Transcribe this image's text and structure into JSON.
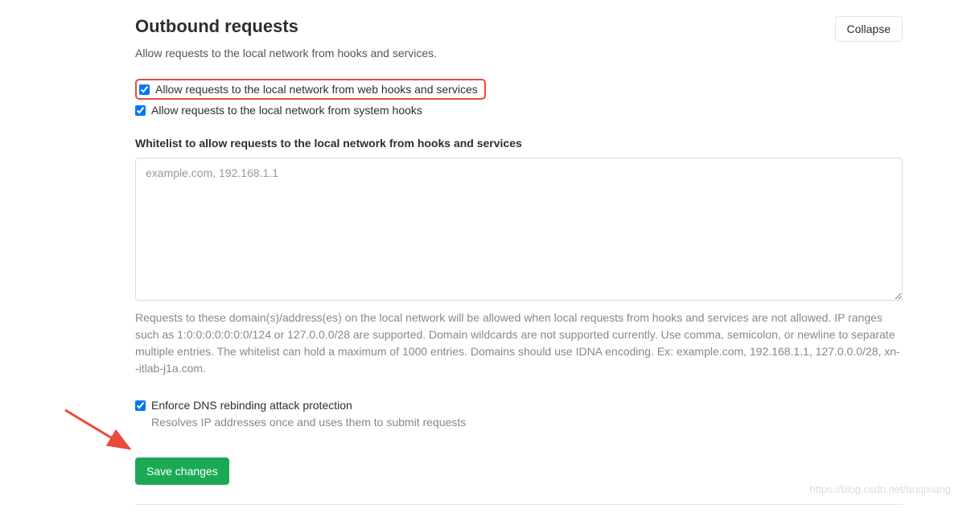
{
  "header": {
    "title": "Outbound requests",
    "subtitle": "Allow requests to the local network from hooks and services.",
    "collapse_label": "Collapse"
  },
  "checkboxes": {
    "allow_web_hooks": {
      "label": "Allow requests to the local network from web hooks and services",
      "checked": true
    },
    "allow_system_hooks": {
      "label": "Allow requests to the local network from system hooks",
      "checked": true
    }
  },
  "whitelist": {
    "label": "Whitelist to allow requests to the local network from hooks and services",
    "placeholder": "example.com, 192.168.1.1",
    "value": "",
    "help": "Requests to these domain(s)/address(es) on the local network will be allowed when local requests from hooks and services are not allowed. IP ranges such as 1:0:0:0:0:0:0:0/124 or 127.0.0.0/28 are supported. Domain wildcards are not supported currently. Use comma, semicolon, or newline to separate multiple entries. The whitelist can hold a maximum of 1000 entries. Domains should use IDNA encoding. Ex: example.com, 192.168.1.1, 127.0.0.0/28, xn--itlab-j1a.com."
  },
  "dns": {
    "label": "Enforce DNS rebinding attack protection",
    "checked": true,
    "sub": "Resolves IP addresses once and uses them to submit requests"
  },
  "save_label": "Save changes",
  "watermark": "https://blog.csdn.net/anqixiang"
}
